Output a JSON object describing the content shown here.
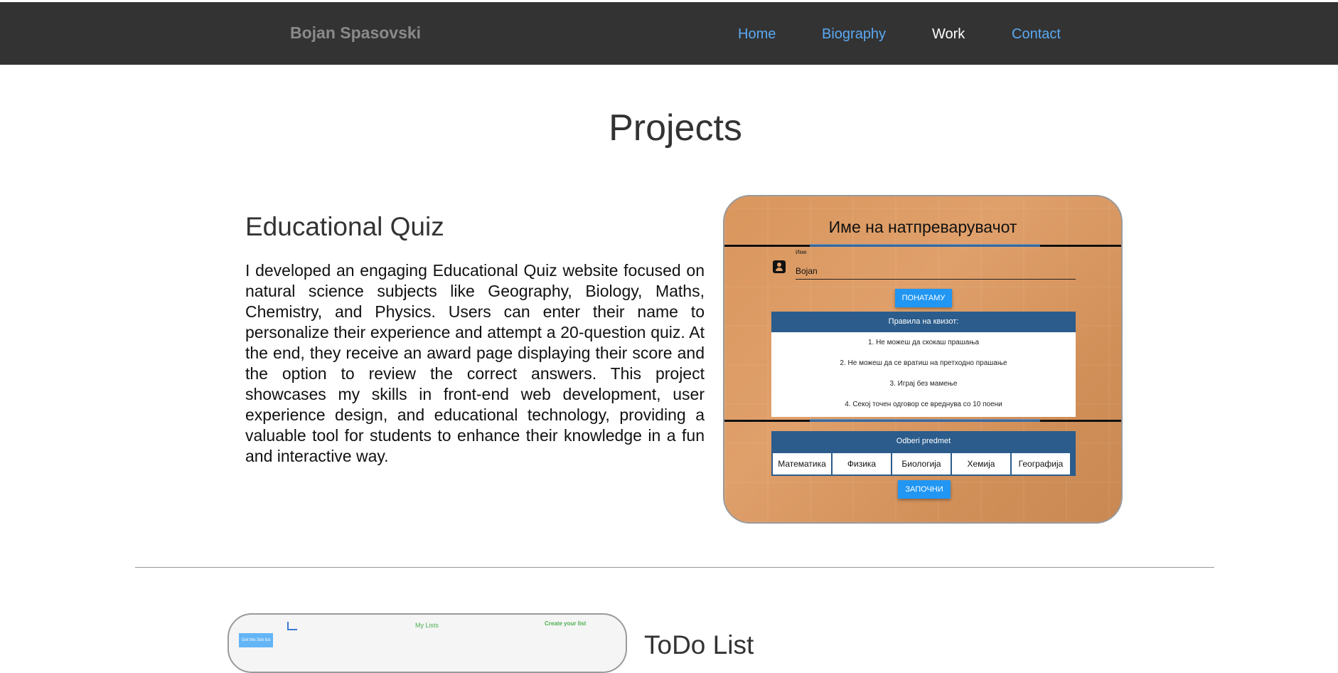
{
  "nav": {
    "brand": "Bojan Spasovski",
    "links": [
      {
        "label": "Home"
      },
      {
        "label": "Biography"
      },
      {
        "label": "Work"
      },
      {
        "label": "Contact"
      }
    ],
    "active": "Work",
    "link_color": "#5aa9f3"
  },
  "page_title": "Projects",
  "project1": {
    "title": "Educational Quiz",
    "description": "I developed an engaging Educational Quiz website focused on natural science subjects like Geography, Biology, Maths, Chemistry, and Physics. Users can enter their name to personalize their experience and attempt a 20-question quiz. At the end, they receive an award page displaying their score and the option to review the correct answers. This project showcases my skills in front-end web development, user experience design, and educational technology, providing a valuable tool for students to enhance their knowledge in a fun and interactive way.",
    "screenshot": {
      "heading": "Име на натпреварувачот",
      "name_label": "Име",
      "name_value": "Bojan",
      "next_button": "ПОНАТАМУ",
      "rules_title": "Правила на квизот:",
      "rules": [
        "1. Не можеш да скокаш прашања",
        "2. Не можеш да се вратиш на претходно прашање",
        "3. Играј без мамење",
        "4. Секој точен одговор се вреднува со 10 поени"
      ],
      "subject_title": "Odberi predmet",
      "subjects": [
        "Математика",
        "Физика",
        "Биологија",
        "Хемија",
        "Географија"
      ],
      "start_button": "ЗАПОЧНИ"
    }
  },
  "project2": {
    "title": "ToDo List",
    "screenshot": {
      "lists_label": "My Lists",
      "create_label": "Create your list",
      "tag_label": "Get the 3do list"
    }
  }
}
